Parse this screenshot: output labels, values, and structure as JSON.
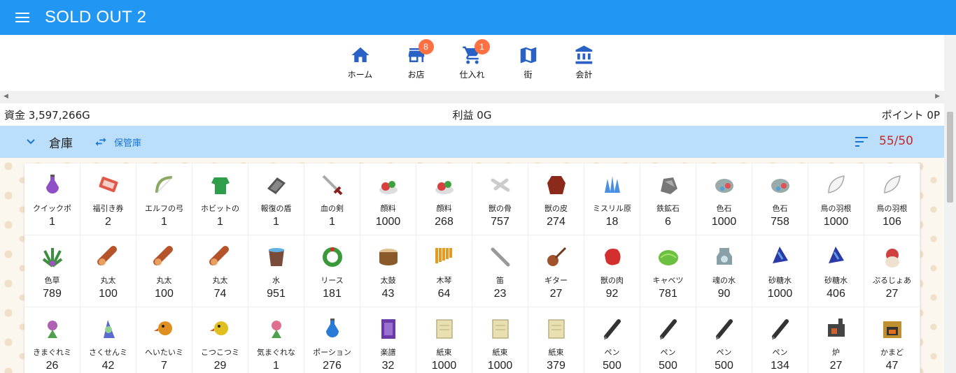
{
  "app": {
    "title": "SOLD OUT 2"
  },
  "nav": [
    {
      "label": "ホーム",
      "icon": "home-icon",
      "badge": ""
    },
    {
      "label": "お店",
      "icon": "store-icon",
      "badge": "8"
    },
    {
      "label": "仕入れ",
      "icon": "cart-icon",
      "badge": "1"
    },
    {
      "label": "街",
      "icon": "map-icon",
      "badge": ""
    },
    {
      "label": "会計",
      "icon": "bank-icon",
      "badge": ""
    }
  ],
  "stats": {
    "funds": "資金 3,597,266G",
    "profit": "利益 0G",
    "points": "ポイント 0P"
  },
  "warehouse": {
    "title": "倉庫",
    "swap_label": "保管庫",
    "capacity": "55/50"
  },
  "colors": {
    "accent": "#2196f3",
    "nav_icon": "#2962c4",
    "badge": "#ff7043",
    "header_bg": "#bbdefb",
    "capacity": "#c62828"
  },
  "items": [
    {
      "name": "クイックポ",
      "qty": "1",
      "icon": "potion-icon",
      "color": "#8e4fc7"
    },
    {
      "name": "福引き券",
      "qty": "2",
      "icon": "ticket-icon",
      "color": "#e05a4a"
    },
    {
      "name": "エルフの弓",
      "qty": "1",
      "icon": "bow-icon",
      "color": "#8aa860"
    },
    {
      "name": "ホビットの",
      "qty": "1",
      "icon": "cloth-icon",
      "color": "#2e9e4a"
    },
    {
      "name": "報復の盾",
      "qty": "1",
      "icon": "shield-icon",
      "color": "#555555"
    },
    {
      "name": "血の剣",
      "qty": "1",
      "icon": "sword-icon",
      "color": "#8b1e1e"
    },
    {
      "name": "顔料",
      "qty": "1000",
      "icon": "pigment-icon",
      "color": "#d84040"
    },
    {
      "name": "顔料",
      "qty": "268",
      "icon": "pigment-icon",
      "color": "#d84040"
    },
    {
      "name": "獣の骨",
      "qty": "757",
      "icon": "bone-icon",
      "color": "#cccccc"
    },
    {
      "name": "獣の皮",
      "qty": "274",
      "icon": "hide-icon",
      "color": "#8b2a1a"
    },
    {
      "name": "ミスリル原",
      "qty": "18",
      "icon": "mithril-icon",
      "color": "#4a90e2"
    },
    {
      "name": "鉄鉱石",
      "qty": "6",
      "icon": "ore-icon",
      "color": "#777777"
    },
    {
      "name": "色石",
      "qty": "1000",
      "icon": "gem-icon",
      "color": "#9aa"
    },
    {
      "name": "色石",
      "qty": "758",
      "icon": "gem-icon",
      "color": "#9aa"
    },
    {
      "name": "鳥の羽根",
      "qty": "1000",
      "icon": "feather-icon",
      "color": "#dddddd"
    },
    {
      "name": "鳥の羽根",
      "qty": "106",
      "icon": "feather-icon",
      "color": "#dddddd"
    },
    {
      "name": "色草",
      "qty": "789",
      "icon": "herb-icon",
      "color": "#3e8e41"
    },
    {
      "name": "丸太",
      "qty": "100",
      "icon": "log-icon",
      "color": "#b5542a"
    },
    {
      "name": "丸太",
      "qty": "100",
      "icon": "log-icon",
      "color": "#b5542a"
    },
    {
      "name": "丸太",
      "qty": "74",
      "icon": "log-icon",
      "color": "#b5542a"
    },
    {
      "name": "水",
      "qty": "951",
      "icon": "water-icon",
      "color": "#7a4a3a"
    },
    {
      "name": "リース",
      "qty": "181",
      "icon": "wreath-icon",
      "color": "#3a9a3a"
    },
    {
      "name": "太鼓",
      "qty": "43",
      "icon": "drum-icon",
      "color": "#8a5a2a"
    },
    {
      "name": "木琴",
      "qty": "64",
      "icon": "xylophone-icon",
      "color": "#e69a20"
    },
    {
      "name": "笛",
      "qty": "23",
      "icon": "flute-icon",
      "color": "#999999"
    },
    {
      "name": "ギター",
      "qty": "27",
      "icon": "guitar-icon",
      "color": "#a0522d"
    },
    {
      "name": "獣の肉",
      "qty": "92",
      "icon": "meat-icon",
      "color": "#d32f2f"
    },
    {
      "name": "キャベツ",
      "qty": "781",
      "icon": "cabbage-icon",
      "color": "#6cc040"
    },
    {
      "name": "魂の水",
      "qty": "90",
      "icon": "soul-water-icon",
      "color": "#8aa0a8"
    },
    {
      "name": "砂糖水",
      "qty": "1000",
      "icon": "sugar-water-icon",
      "color": "#2a3aa8"
    },
    {
      "name": "砂糖水",
      "qty": "406",
      "icon": "sugar-water-icon",
      "color": "#2a3aa8"
    },
    {
      "name": "ぷるじょあ",
      "qty": "27",
      "icon": "penguin-icon",
      "color": "#d04040"
    },
    {
      "name": "きまぐれミ",
      "qty": "26",
      "icon": "fairy-icon",
      "color": "#b060b0"
    },
    {
      "name": "さくせんミ",
      "qty": "42",
      "icon": "mage-icon",
      "color": "#5a6ad0"
    },
    {
      "name": "へいたいミ",
      "qty": "7",
      "icon": "bird-icon",
      "color": "#e09020"
    },
    {
      "name": "こつこつミ",
      "qty": "29",
      "icon": "bird-icon",
      "color": "#e0c020"
    },
    {
      "name": "気まぐれな",
      "qty": "1",
      "icon": "fairy-icon",
      "color": "#e07090"
    },
    {
      "name": "ポーション",
      "qty": "276",
      "icon": "potion-icon",
      "color": "#2a7ad8"
    },
    {
      "name": "楽譜",
      "qty": "32",
      "icon": "score-icon",
      "color": "#6a3aa8"
    },
    {
      "name": "紙束",
      "qty": "1000",
      "icon": "paper-icon",
      "color": "#e8e0b0"
    },
    {
      "name": "紙束",
      "qty": "1000",
      "icon": "paper-icon",
      "color": "#e8e0b0"
    },
    {
      "name": "紙束",
      "qty": "379",
      "icon": "paper-icon",
      "color": "#e8e0b0"
    },
    {
      "name": "ペン",
      "qty": "500",
      "icon": "pen-icon",
      "color": "#333333"
    },
    {
      "name": "ペン",
      "qty": "500",
      "icon": "pen-icon",
      "color": "#333333"
    },
    {
      "name": "ペン",
      "qty": "500",
      "icon": "pen-icon",
      "color": "#333333"
    },
    {
      "name": "ペン",
      "qty": "134",
      "icon": "pen-icon",
      "color": "#333333"
    },
    {
      "name": "炉",
      "qty": "27",
      "icon": "furnace-icon",
      "color": "#444444"
    },
    {
      "name": "かまど",
      "qty": "47",
      "icon": "oven-icon",
      "color": "#c09030"
    }
  ]
}
